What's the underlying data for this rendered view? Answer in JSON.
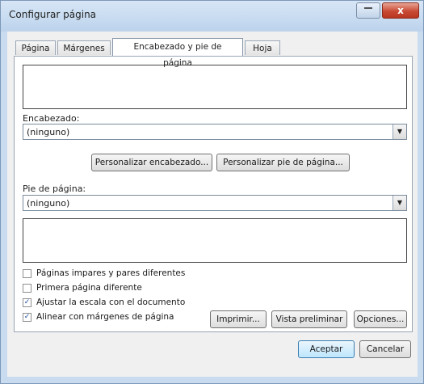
{
  "window": {
    "title": "Configurar página",
    "close_glyph": "x"
  },
  "tabs": [
    {
      "label": "Página",
      "active": false
    },
    {
      "label": "Márgenes",
      "active": false
    },
    {
      "label": "Encabezado y pie de página",
      "active": true
    },
    {
      "label": "Hoja",
      "active": false
    }
  ],
  "header": {
    "label": "Encabezado:",
    "value": "(ninguno)",
    "customize_button": "Personalizar encabezado..."
  },
  "footer": {
    "label": "Pie de página:",
    "value": "(ninguno)",
    "customize_button": "Personalizar pie de página..."
  },
  "options": [
    {
      "label": "Páginas impares y pares diferentes",
      "checked": false
    },
    {
      "label": "Primera página diferente",
      "checked": false
    },
    {
      "label": "Ajustar la escala con el documento",
      "checked": true
    },
    {
      "label": "Alinear con márgenes de página",
      "checked": true
    }
  ],
  "panel_buttons": {
    "print": "Imprimir...",
    "preview": "Vista preliminar",
    "options": "Opciones..."
  },
  "dialog_buttons": {
    "ok": "Aceptar",
    "cancel": "Cancelar"
  },
  "icons": {
    "dropdown": "chevron-down-icon",
    "check": "check-icon"
  }
}
